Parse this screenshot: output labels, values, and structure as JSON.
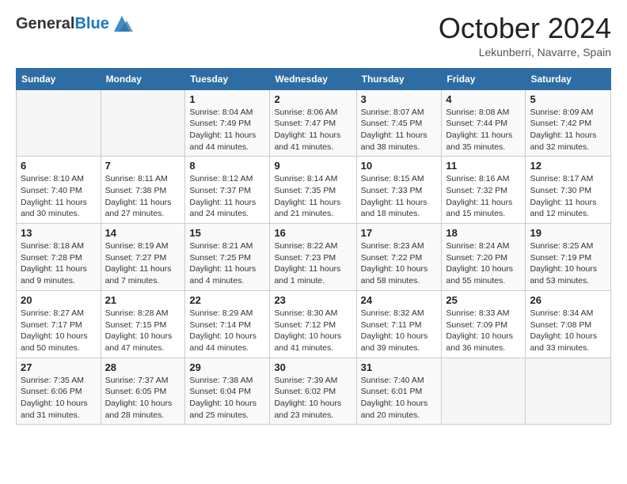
{
  "logo": {
    "general": "General",
    "blue": "Blue"
  },
  "header": {
    "month": "October 2024",
    "location": "Lekunberri, Navarre, Spain"
  },
  "weekdays": [
    "Sunday",
    "Monday",
    "Tuesday",
    "Wednesday",
    "Thursday",
    "Friday",
    "Saturday"
  ],
  "weeks": [
    [
      {
        "day": "",
        "info": ""
      },
      {
        "day": "",
        "info": ""
      },
      {
        "day": "1",
        "info": "Sunrise: 8:04 AM\nSunset: 7:49 PM\nDaylight: 11 hours and 44 minutes."
      },
      {
        "day": "2",
        "info": "Sunrise: 8:06 AM\nSunset: 7:47 PM\nDaylight: 11 hours and 41 minutes."
      },
      {
        "day": "3",
        "info": "Sunrise: 8:07 AM\nSunset: 7:45 PM\nDaylight: 11 hours and 38 minutes."
      },
      {
        "day": "4",
        "info": "Sunrise: 8:08 AM\nSunset: 7:44 PM\nDaylight: 11 hours and 35 minutes."
      },
      {
        "day": "5",
        "info": "Sunrise: 8:09 AM\nSunset: 7:42 PM\nDaylight: 11 hours and 32 minutes."
      }
    ],
    [
      {
        "day": "6",
        "info": "Sunrise: 8:10 AM\nSunset: 7:40 PM\nDaylight: 11 hours and 30 minutes."
      },
      {
        "day": "7",
        "info": "Sunrise: 8:11 AM\nSunset: 7:38 PM\nDaylight: 11 hours and 27 minutes."
      },
      {
        "day": "8",
        "info": "Sunrise: 8:12 AM\nSunset: 7:37 PM\nDaylight: 11 hours and 24 minutes."
      },
      {
        "day": "9",
        "info": "Sunrise: 8:14 AM\nSunset: 7:35 PM\nDaylight: 11 hours and 21 minutes."
      },
      {
        "day": "10",
        "info": "Sunrise: 8:15 AM\nSunset: 7:33 PM\nDaylight: 11 hours and 18 minutes."
      },
      {
        "day": "11",
        "info": "Sunrise: 8:16 AM\nSunset: 7:32 PM\nDaylight: 11 hours and 15 minutes."
      },
      {
        "day": "12",
        "info": "Sunrise: 8:17 AM\nSunset: 7:30 PM\nDaylight: 11 hours and 12 minutes."
      }
    ],
    [
      {
        "day": "13",
        "info": "Sunrise: 8:18 AM\nSunset: 7:28 PM\nDaylight: 11 hours and 9 minutes."
      },
      {
        "day": "14",
        "info": "Sunrise: 8:19 AM\nSunset: 7:27 PM\nDaylight: 11 hours and 7 minutes."
      },
      {
        "day": "15",
        "info": "Sunrise: 8:21 AM\nSunset: 7:25 PM\nDaylight: 11 hours and 4 minutes."
      },
      {
        "day": "16",
        "info": "Sunrise: 8:22 AM\nSunset: 7:23 PM\nDaylight: 11 hours and 1 minute."
      },
      {
        "day": "17",
        "info": "Sunrise: 8:23 AM\nSunset: 7:22 PM\nDaylight: 10 hours and 58 minutes."
      },
      {
        "day": "18",
        "info": "Sunrise: 8:24 AM\nSunset: 7:20 PM\nDaylight: 10 hours and 55 minutes."
      },
      {
        "day": "19",
        "info": "Sunrise: 8:25 AM\nSunset: 7:19 PM\nDaylight: 10 hours and 53 minutes."
      }
    ],
    [
      {
        "day": "20",
        "info": "Sunrise: 8:27 AM\nSunset: 7:17 PM\nDaylight: 10 hours and 50 minutes."
      },
      {
        "day": "21",
        "info": "Sunrise: 8:28 AM\nSunset: 7:15 PM\nDaylight: 10 hours and 47 minutes."
      },
      {
        "day": "22",
        "info": "Sunrise: 8:29 AM\nSunset: 7:14 PM\nDaylight: 10 hours and 44 minutes."
      },
      {
        "day": "23",
        "info": "Sunrise: 8:30 AM\nSunset: 7:12 PM\nDaylight: 10 hours and 41 minutes."
      },
      {
        "day": "24",
        "info": "Sunrise: 8:32 AM\nSunset: 7:11 PM\nDaylight: 10 hours and 39 minutes."
      },
      {
        "day": "25",
        "info": "Sunrise: 8:33 AM\nSunset: 7:09 PM\nDaylight: 10 hours and 36 minutes."
      },
      {
        "day": "26",
        "info": "Sunrise: 8:34 AM\nSunset: 7:08 PM\nDaylight: 10 hours and 33 minutes."
      }
    ],
    [
      {
        "day": "27",
        "info": "Sunrise: 7:35 AM\nSunset: 6:06 PM\nDaylight: 10 hours and 31 minutes."
      },
      {
        "day": "28",
        "info": "Sunrise: 7:37 AM\nSunset: 6:05 PM\nDaylight: 10 hours and 28 minutes."
      },
      {
        "day": "29",
        "info": "Sunrise: 7:38 AM\nSunset: 6:04 PM\nDaylight: 10 hours and 25 minutes."
      },
      {
        "day": "30",
        "info": "Sunrise: 7:39 AM\nSunset: 6:02 PM\nDaylight: 10 hours and 23 minutes."
      },
      {
        "day": "31",
        "info": "Sunrise: 7:40 AM\nSunset: 6:01 PM\nDaylight: 10 hours and 20 minutes."
      },
      {
        "day": "",
        "info": ""
      },
      {
        "day": "",
        "info": ""
      }
    ]
  ]
}
